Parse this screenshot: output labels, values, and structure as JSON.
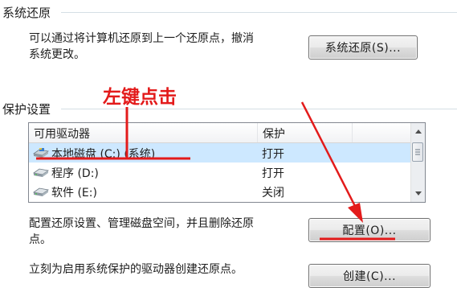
{
  "system_restore": {
    "section_title": "系统还原",
    "desc_line1": "可以通过将计算机还原到上一个还原点，撤消",
    "desc_line2": "系统更改。",
    "button_label": "系统还原(S)..."
  },
  "protection": {
    "section_title": "保护设置",
    "columns": [
      "可用驱动器",
      "保护"
    ],
    "drives": [
      {
        "name": "本地磁盘 (C:) (系统)",
        "protection": "打开",
        "selected": true
      },
      {
        "name": "程序 (D:)",
        "protection": "打开",
        "selected": false
      },
      {
        "name": "软件 (E:)",
        "protection": "关闭",
        "selected": false
      }
    ]
  },
  "configure": {
    "desc_line1": "配置还原设置、管理磁盘空间，并且删除还原",
    "desc_line2": "点。",
    "button_label": "配置(O)..."
  },
  "create": {
    "desc": "立刻为启用系统保护的驱动器创建还原点。",
    "button_label": "创建(C)..."
  },
  "annotation": {
    "text": "左键点击",
    "color": "#e31b1b"
  },
  "icons": [
    "drive-icon",
    "scroll-up-arrow-icon",
    "scroll-down-arrow-icon"
  ]
}
